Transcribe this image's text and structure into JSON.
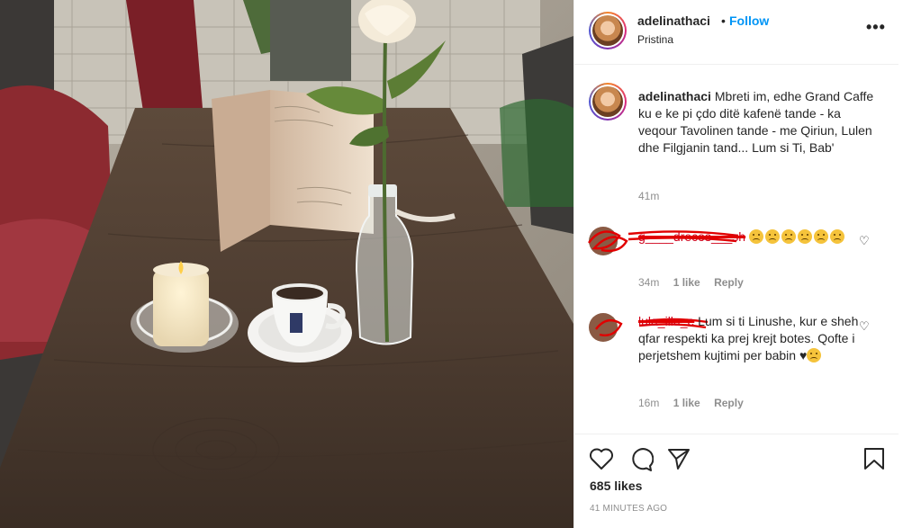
{
  "post": {
    "image": {
      "alt": "Cafe table with a candle, espresso cup, reserved card and a rose in a bottle"
    }
  },
  "header": {
    "username": "adelinathaci",
    "separator": "•",
    "follow_label": "Follow",
    "location": "Pristina",
    "more_label": "•••"
  },
  "caption": {
    "username": "adelinathaci",
    "text": "Mbreti im, edhe Grand Caffe ku e ke pi çdo ditë kafenë tande - ka veqour Tavolinen tande - me Qiriun, Lulen dhe Filgjanin tand... Lum si Ti, Bab'",
    "time": "41m"
  },
  "comments": [
    {
      "username": "g____drecos___sh",
      "emoji_count": 6,
      "time": "34m",
      "likes": "1 like",
      "reply_label": "Reply"
    },
    {
      "username": "lula_illu_e",
      "text": "Lum si ti Linushe, kur e sheh qfar respekti ka prej krejt botes. Qofte i perjetshem kujtimi per babin",
      "trailing": "♥",
      "time": "16m",
      "likes": "1 like",
      "reply_label": "Reply"
    }
  ],
  "footer": {
    "likes": "685 likes",
    "timestamp": "41 MINUTES AGO"
  },
  "colors": {
    "accent": "#0095f6",
    "text": "#262626",
    "muted": "#8e8e8e",
    "scribble": "#e10000"
  },
  "icons": [
    "heart-icon",
    "comment-icon",
    "share-icon",
    "save-icon",
    "more-icon"
  ]
}
